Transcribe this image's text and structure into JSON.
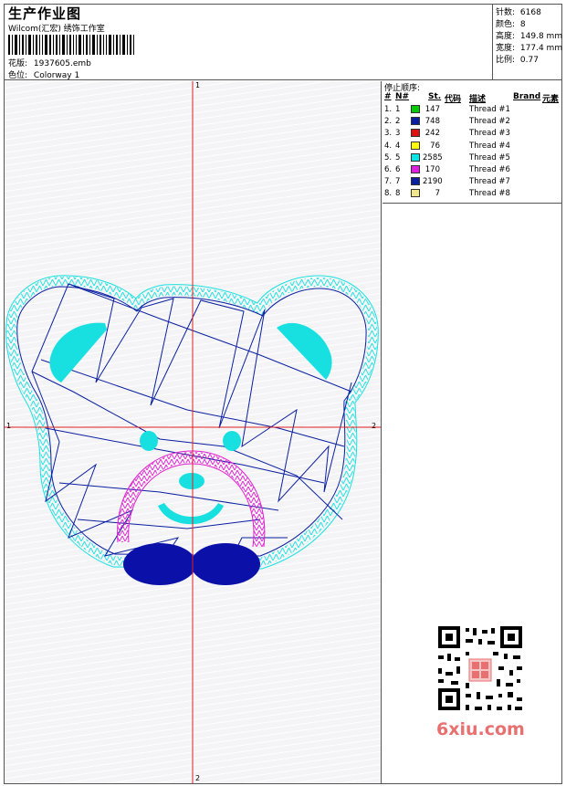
{
  "header": {
    "title": "生产作业图",
    "company": "Wilcom(汇宏) 绣饰工作室",
    "design_label": "花版:",
    "design_value": "1937605.emb",
    "colorway_label": "色位:",
    "colorway_value": "Colorway 1"
  },
  "stats": [
    {
      "label": "针数:",
      "value": "6168"
    },
    {
      "label": "颜色:",
      "value": "8"
    },
    {
      "label": "高度:",
      "value": "149.8 mm"
    },
    {
      "label": "宽度:",
      "value": "177.4 mm"
    },
    {
      "label": "比例:",
      "value": "0.77"
    }
  ],
  "axes": {
    "top": "1",
    "bottom": "2",
    "left": "1",
    "right": "2"
  },
  "thread_panel": {
    "title": "停止顺序:",
    "columns": [
      "#",
      "N#",
      "St.",
      "代码",
      "描述",
      "Brand",
      "元素"
    ],
    "rows": [
      {
        "num": "1.",
        "n": "1",
        "color": "#00cc00",
        "stitches": "147",
        "desc": "Thread #1"
      },
      {
        "num": "2.",
        "n": "2",
        "color": "#0a1fa0",
        "stitches": "748",
        "desc": "Thread #2"
      },
      {
        "num": "3.",
        "n": "3",
        "color": "#e01010",
        "stitches": "242",
        "desc": "Thread #3"
      },
      {
        "num": "4.",
        "n": "4",
        "color": "#ffff00",
        "stitches": "76",
        "desc": "Thread #4"
      },
      {
        "num": "5.",
        "n": "5",
        "color": "#00e5e5",
        "stitches": "2585",
        "desc": "Thread #5"
      },
      {
        "num": "6.",
        "n": "6",
        "color": "#e020e0",
        "stitches": "170",
        "desc": "Thread #6"
      },
      {
        "num": "7.",
        "n": "7",
        "color": "#0a1fa0",
        "stitches": "2190",
        "desc": "Thread #7"
      },
      {
        "num": "8.",
        "n": "8",
        "color": "#f2e68a",
        "stitches": "7",
        "desc": "Thread #8"
      }
    ]
  },
  "watermark": "6xiu.com",
  "colors": {
    "axis": "#e02020",
    "outline_cyan": "#19e0e0",
    "outline_blue": "#0a1fa0",
    "pink": "#e020d0",
    "navy": "#0a10a8"
  }
}
